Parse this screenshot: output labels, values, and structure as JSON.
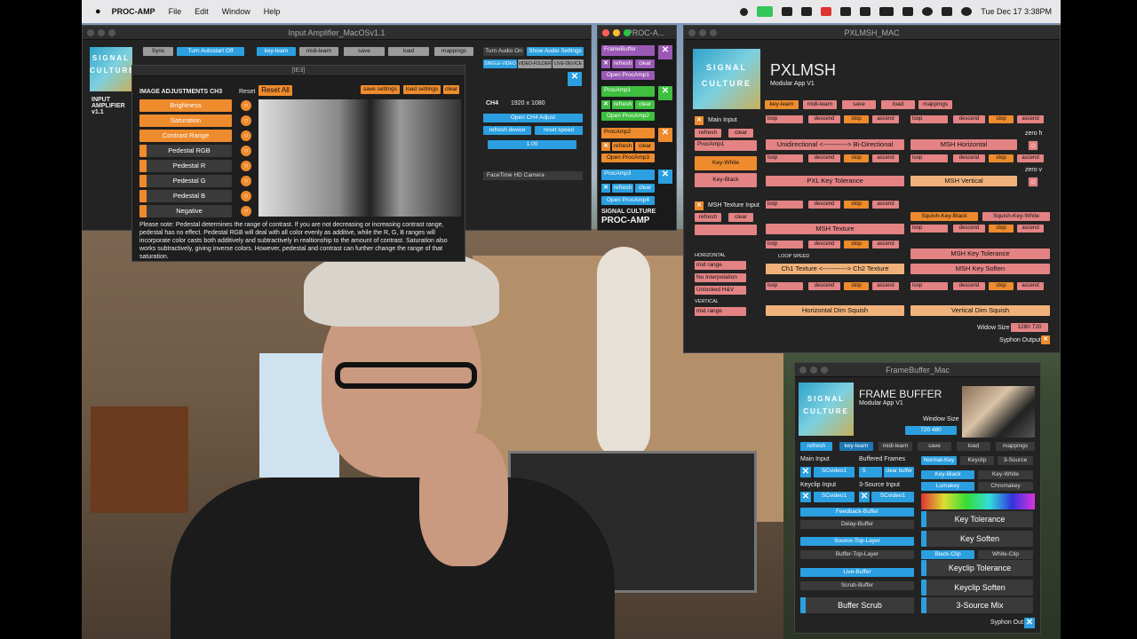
{
  "menubar": {
    "app": "PROC-AMP",
    "items": [
      "File",
      "Edit",
      "Window",
      "Help"
    ],
    "clock": "Tue Dec 17  3:38PM"
  },
  "input_amp": {
    "title": "Input Amplifier_MacOSv1.1",
    "sync": "Sync",
    "autostart": "Turn Autostart Off",
    "keylearn": "key-learn",
    "midilearn": "midi-learn",
    "save": "save",
    "load": "load",
    "mappings": "mappings",
    "turn_audio_on": "Turn Audio On",
    "show_audio": "Show Audio Settings",
    "single_video": "SINGLE-VIDEO",
    "video_folder": "VIDEO-FOLDER",
    "live_device": "LIVE-DEVICE",
    "brand": "INPUT AMPLIFIER v1.1",
    "ch4": "CH4",
    "res": "1920 x 1080",
    "open_ch4": "Open CH4 Adjust",
    "refresh_device": "refresh device",
    "reset_speed": "reset speed",
    "speed": "1.00",
    "camera": "FaceTime HD Camera"
  },
  "image_adj": {
    "sub": "[IE3]",
    "heading": "IMAGE ADJUSTMENTS CH3",
    "reset": "Reset",
    "reset_all": "Reset All",
    "save_settings": "save settings",
    "load_settings": "load settings",
    "clear": "clear",
    "sliders": [
      "Brightness",
      "Saturation",
      "Contrast Range",
      "Pedestal RGB",
      "Pedestal R",
      "Pedestal G",
      "Pedestal B",
      "Negative"
    ],
    "note": "Please note: Pedestal determines the range of contrast. If you are not decreasing or increasing contrast range, pedestal has no effect. Pedestal RGB will deal with all color evenly as additive, while the R, G, B ranges will incorporate color casts both additively and subtractively in realtionship to the amount of contrast. Saturation also works subtractively, giving inverse colors. However, pedestal and contrast can further change the range of that saturation."
  },
  "procamp": {
    "title": "PROC-A...",
    "fb": "FrameBuffer",
    "refresh": "refresh",
    "clear": "clear",
    "open_proc1": "Open ProcAmp1",
    "pa1": "ProcAmp1",
    "open_proc2": "Open ProcAmp2",
    "pa2": "ProcAmp2",
    "open_proc3": "Open ProcAmp3",
    "pa3": "ProcAmp3",
    "open_proc4": "Open ProcAmp4",
    "brand1": "SIGNAL CULTURE",
    "brand2": "PROC-AMP"
  },
  "pxlmsh": {
    "title": "PXLMSH_MAC",
    "name": "PXLMSH",
    "sub": "Modular App V1",
    "keylearn": "key-learn",
    "midilearn": "midi-learn",
    "save": "save",
    "load": "load",
    "mappings": "mappings",
    "main_input": "Main Input",
    "refresh": "refresh",
    "clear": "clear",
    "procamp1": "ProcAmp1",
    "key_white": "Key-White",
    "key_black": "Key-Black",
    "msh_tex_input": "MSH Texture Input",
    "horizontal": "HORIZONTAL",
    "mid_range": "mid range",
    "no_interp": "No Interpolation",
    "unlocked": "Unlocked H&V",
    "vertical": "VERTICAL",
    "mid_range2": "mid range",
    "loop": "loop",
    "descend": "descend",
    "stop": "stop",
    "ascend": "ascend",
    "uni_bi": "Unidirectional <-----------> Bi-Directional",
    "msh_h": "MSH Horizontal",
    "zero_h": "zero h",
    "zero_v": "zero v",
    "pxl_key_tol": "PXL Key Tolerance",
    "msh_v": "MSH Vertical",
    "squish_black": "Squish-Key-Black",
    "squish_white": "Squish-Key-White",
    "msh_tex": "MSH Texture",
    "msh_key_tol": "MSH Key Tolerance",
    "loop_speed": "LOOP SPEED",
    "ch1_ch2": "Ch1 Texture <-----------> Ch2 Texture",
    "msh_key_soft": "MSH Key Soften",
    "h_dim": "Horizontal Dim Squish",
    "v_dim": "Vertical Dim Squish",
    "widow_size": "Widow Size",
    "size_val": "1280 720",
    "syphon": "Syphon Output"
  },
  "framebuffer": {
    "title": "FrameBuffer_Mac",
    "name": "FRAME BUFFER",
    "sub": "Modular App V1",
    "window_size": "Window Size",
    "size_val": "720 480",
    "refresh": "refresh",
    "keylearn": "key-learn",
    "midilearn": "midi-learn",
    "save": "save",
    "load": "load",
    "mappings": "mappings",
    "main_input": "Main Input",
    "buffered": "Buffered Frames",
    "scvideo1": "SCvideo1",
    "frames": "5",
    "clear_buffer": "clear buffer",
    "keyclip_input": "Keyclip Input",
    "three_src_input": "3-Source Input",
    "feedback": "Feedback-Buffer",
    "delay": "Delay-Buffer",
    "src_top": "Source-Top-Layer",
    "buf_top": "Buffer-Top-Layer",
    "live": "Live-Buffer",
    "scrub": "Scrub-Buffer",
    "buf_scrub": "Buffer Scrub",
    "normal_key": "Normal-Key",
    "keyclip": "Keyclip",
    "three_source": "3-Source",
    "key_black": "Key-Black",
    "key_white": "Key-White",
    "lumakey": "Lumakey",
    "chromakey": "Chromakey",
    "key_tol": "Key Tolerance",
    "key_soft": "Key Soften",
    "black_clip": "Black-Clip",
    "white_clip": "White-Clip",
    "kc_tol": "Keyclip Tolerance",
    "kc_soft": "Keyclip Soften",
    "three_mix": "3-Source Mix",
    "syphon": "Syphon Out:"
  },
  "signal_logo": [
    "SIGNAL",
    "CULTURE"
  ]
}
